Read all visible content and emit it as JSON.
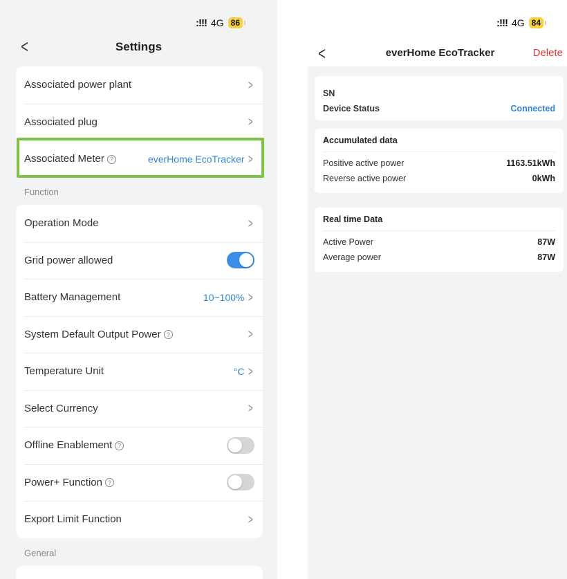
{
  "left": {
    "status": {
      "network": "4G",
      "battery": "86"
    },
    "title": "Settings",
    "items_top": [
      {
        "label": "Associated power plant",
        "value": ""
      },
      {
        "label": "Associated plug",
        "value": ""
      },
      {
        "label": "Associated Meter",
        "value": "everHome EcoTracker"
      }
    ],
    "section_function": "Function",
    "items_function": [
      {
        "label": "Operation Mode"
      },
      {
        "label": "Grid power allowed",
        "toggle": "on"
      },
      {
        "label": "Battery Management",
        "value": "10~100%"
      },
      {
        "label": "System Default Output Power"
      },
      {
        "label": "Temperature Unit",
        "value": "°C"
      },
      {
        "label": "Select Currency"
      },
      {
        "label": "Offline Enablement",
        "toggle": "off"
      },
      {
        "label": "Power+ Function",
        "toggle": "off"
      },
      {
        "label": "Export Limit Function"
      }
    ],
    "section_general": "General"
  },
  "right": {
    "status": {
      "network": "4G",
      "battery": "84"
    },
    "title": "everHome EcoTracker",
    "delete_label": "Delete",
    "device": {
      "sn_label": "SN",
      "status_label": "Device Status",
      "status_value": "Connected"
    },
    "accumulated": {
      "title": "Accumulated data",
      "positive_label": "Positive active power",
      "positive_value": "1163.51kWh",
      "reverse_label": "Reverse active power",
      "reverse_value": "0kWh"
    },
    "realtime": {
      "title": "Real time Data",
      "active_label": "Active Power",
      "active_value": "87W",
      "average_label": "Average power",
      "average_value": "87W"
    }
  },
  "colors": {
    "accent": "#2f86d8",
    "highlight": "#7dc242",
    "delete": "#e8382e",
    "battery": "#f6d23a"
  }
}
